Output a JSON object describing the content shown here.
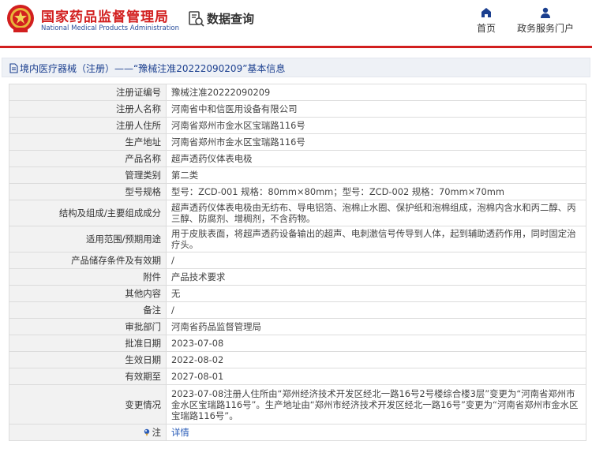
{
  "header": {
    "org_name": "国家药品监督管理局",
    "org_name_en": "National Medical Products Administration",
    "site_title": "数据查询",
    "nav": [
      {
        "label": "首页",
        "icon": "home-icon"
      },
      {
        "label": "政务服务门户",
        "icon": "user-icon"
      }
    ]
  },
  "section": {
    "title": "境内医疗器械（注册）——“豫械注准20222090209”基本信息"
  },
  "detail": {
    "rows": [
      {
        "label": "注册证编号",
        "value": "豫械注准20222090209"
      },
      {
        "label": "注册人名称",
        "value": "河南省中和信医用设备有限公司"
      },
      {
        "label": "注册人住所",
        "value": "河南省郑州市金水区宝瑞路116号"
      },
      {
        "label": "生产地址",
        "value": "河南省郑州市金水区宝瑞路116号"
      },
      {
        "label": "产品名称",
        "value": "超声透药仪体表电极"
      },
      {
        "label": "管理类别",
        "value": "第二类"
      },
      {
        "label": "型号规格",
        "value": "型号：ZCD-001 规格：80mm×80mm；型号：ZCD-002 规格：70mm×70mm"
      },
      {
        "label": "结构及组成/主要组成成分",
        "value": "超声透药仪体表电极由无纺布、导电铝箔、泡棉止水圈、保护纸和泡棉组成，泡棉内含水和丙二醇、丙三醇、防腐剂、增稠剂，不含药物。"
      },
      {
        "label": "适用范围/预期用途",
        "value": "用于皮肤表面，将超声透药设备输出的超声、电刺激信号传导到人体，起到辅助透药作用，同时固定治疗头。"
      },
      {
        "label": "产品储存条件及有效期",
        "value": "/"
      },
      {
        "label": "附件",
        "value": "产品技术要求"
      },
      {
        "label": "其他内容",
        "value": "无"
      },
      {
        "label": "备注",
        "value": "/"
      },
      {
        "label": "审批部门",
        "value": "河南省药品监督管理局"
      },
      {
        "label": "批准日期",
        "value": "2023-07-08"
      },
      {
        "label": "生效日期",
        "value": "2022-08-02"
      },
      {
        "label": "有效期至",
        "value": "2027-08-01"
      },
      {
        "label": "变更情况",
        "value": "2023-07-08注册人住所由“郑州经济技术开发区经北一路16号2号楼综合楼3层”变更为“河南省郑州市金水区宝瑞路116号”。生产地址由“郑州市经济技术开发区经北一路16号”变更为“河南省郑州市金水区宝瑞路116号”。"
      }
    ],
    "note": {
      "label": "注",
      "icon": "pin-icon",
      "value": "详情"
    }
  },
  "colors": {
    "brand_red": "#d21f1f",
    "brand_blue": "#1b3f8f",
    "label_bg": "#f2f2f2",
    "link_blue": "#2a5cb8"
  }
}
